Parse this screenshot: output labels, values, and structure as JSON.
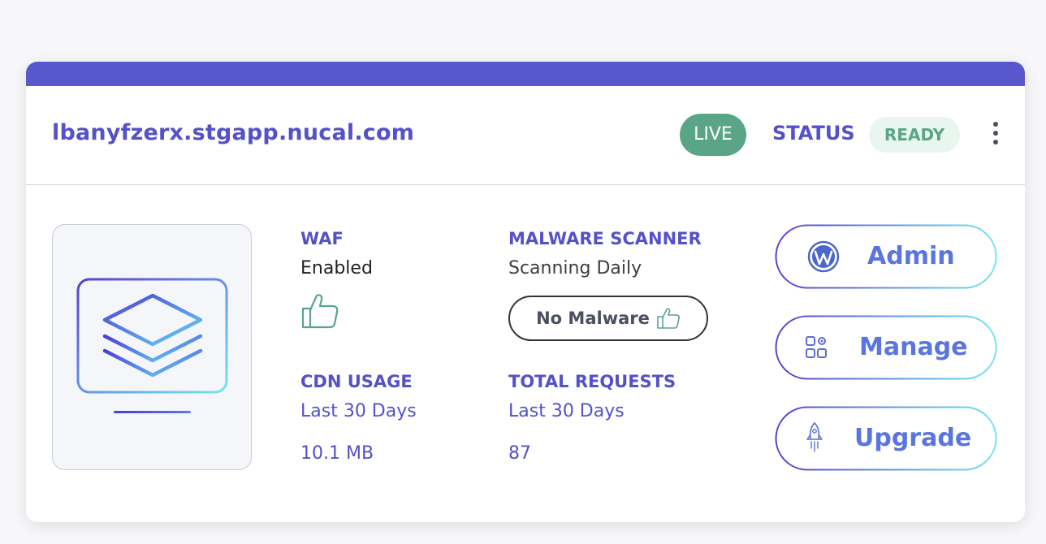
{
  "header": {
    "domain": "lbanyfzerx.stgapp.nucal.com",
    "live_badge": "LIVE",
    "status_label": "STATUS",
    "status_value": "READY"
  },
  "waf": {
    "label": "WAF",
    "value": "Enabled"
  },
  "malware": {
    "label": "MALWARE SCANNER",
    "value": "Scanning Daily",
    "result": "No Malware"
  },
  "cdn": {
    "label": "CDN USAGE",
    "period": "Last 30 Days",
    "value": "10.1 MB"
  },
  "requests": {
    "label": "TOTAL REQUESTS",
    "period": "Last 30 Days",
    "value": "87"
  },
  "actions": [
    {
      "label": "Admin",
      "icon": "wordpress-icon"
    },
    {
      "label": "Manage",
      "icon": "apps-settings-icon"
    },
    {
      "label": "Upgrade",
      "icon": "rocket-icon"
    }
  ],
  "colors": {
    "primary": "#5858cc",
    "accent_text": "#5451c9",
    "live_green": "#5aa588",
    "ready_bg": "#e9f5ef",
    "gradient_start": "#5a4fd6",
    "gradient_end": "#6fe6f2"
  }
}
